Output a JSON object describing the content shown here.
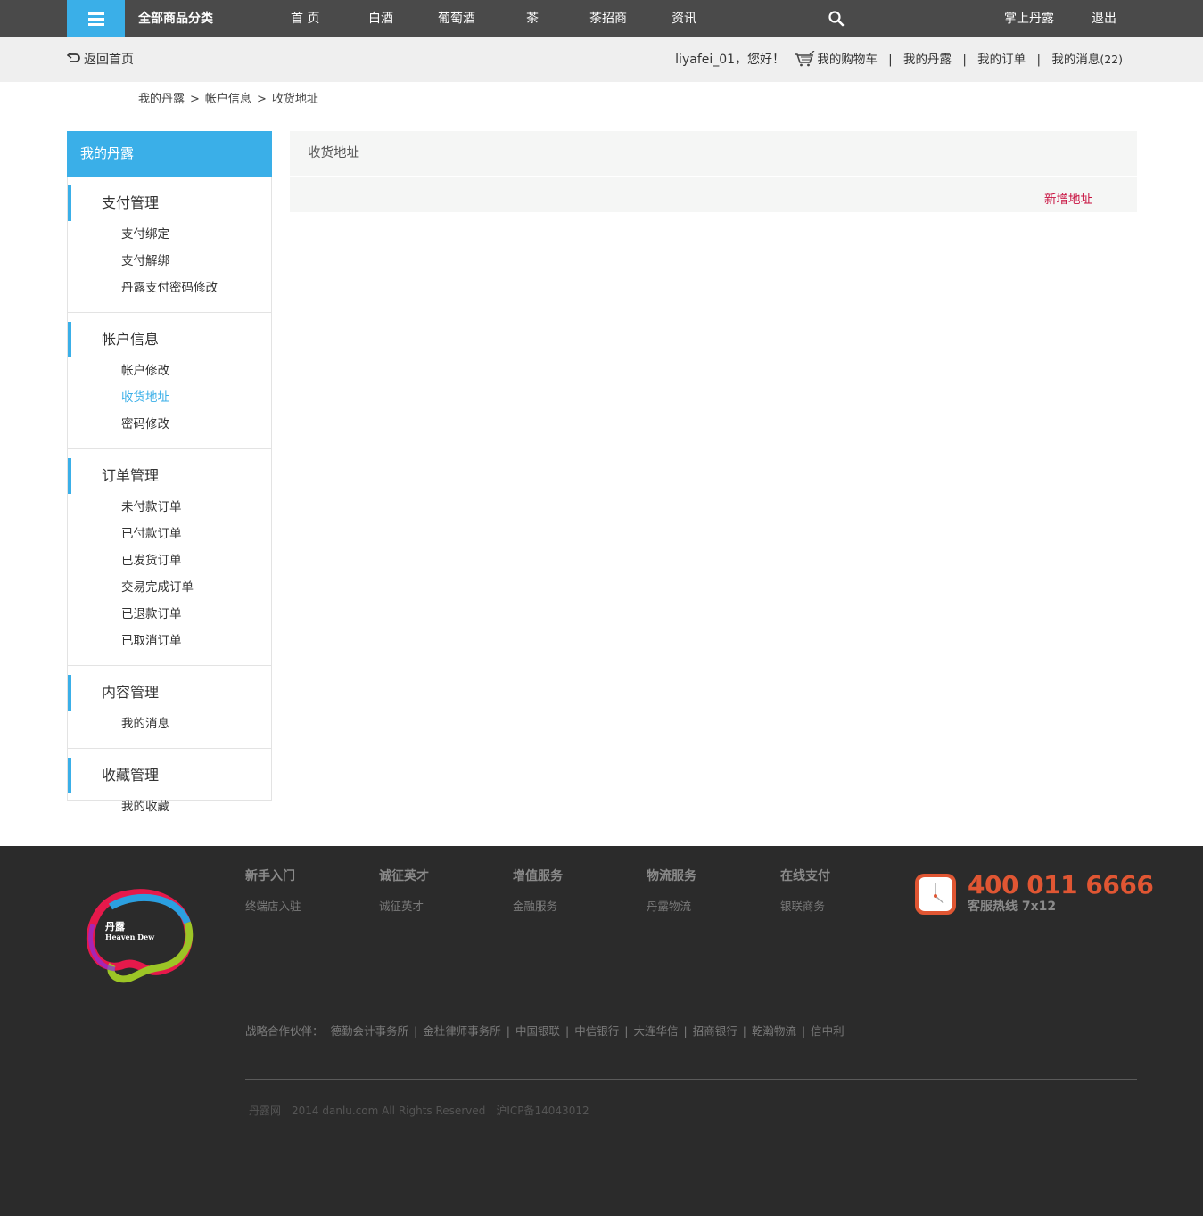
{
  "topnav": {
    "category_label": "全部商品分类",
    "links": [
      "首 页",
      "白酒",
      "葡萄酒",
      "茶",
      "茶招商",
      "资讯"
    ],
    "mobile_label": "掌上丹露",
    "logout_label": "退出"
  },
  "subbar": {
    "back_label": "返回首页",
    "greeting": "liyafei_01，您好！",
    "cart_label": "我的购物车",
    "my_danlu_label": "我的丹露",
    "orders_label": "我的订单",
    "messages_label": "我的消息",
    "messages_count": "(22)"
  },
  "breadcrumb": [
    "我的丹露",
    "帐户信息",
    "收货地址"
  ],
  "sidebar": {
    "title": "我的丹露",
    "groups": [
      {
        "title": "支付管理",
        "items": [
          "支付绑定",
          "支付解绑",
          "丹露支付密码修改"
        ]
      },
      {
        "title": "帐户信息",
        "items": [
          "帐户修改",
          "收货地址",
          "密码修改"
        ]
      },
      {
        "title": "订单管理",
        "items": [
          "未付款订单",
          "已付款订单",
          "已发货订单",
          "交易完成订单",
          "已退款订单",
          "已取消订单"
        ]
      },
      {
        "title": "内容管理",
        "items": [
          "我的消息"
        ]
      },
      {
        "title": "收藏管理",
        "items": [
          "我的收藏"
        ]
      }
    ],
    "active_item": "收货地址"
  },
  "main": {
    "title": "收货地址",
    "add_label": "新增地址"
  },
  "footer": {
    "logo_text": "丹露",
    "logo_sub": "Heaven Dew",
    "columns": [
      {
        "title": "新手入门",
        "link": "终端店入驻"
      },
      {
        "title": "诚征英才",
        "link": "诚征英才"
      },
      {
        "title": "增值服务",
        "link": "金融服务"
      },
      {
        "title": "物流服务",
        "link": "丹露物流"
      },
      {
        "title": "在线支付",
        "link": "银联商务"
      }
    ],
    "hotline_number": "400 011 6666",
    "hotline_label": "客服热线 7x12",
    "partners_label": "战略合作伙伴：",
    "partners": [
      "德勤会计事务所",
      "金杜律师事务所",
      "中国银联",
      "中信银行",
      "大连华信",
      "招商银行",
      "乾瀚物流",
      "信中利"
    ],
    "copyright": [
      "丹露网",
      "2014 danlu.com All Rights Reserved",
      "沪ICP备14043012"
    ]
  },
  "colors": {
    "accent": "#3aafe8",
    "nav_bg": "#4a4a4a",
    "add_link": "#c8103f",
    "hotline": "#e05633",
    "footer_bg": "#2b2b2b"
  }
}
